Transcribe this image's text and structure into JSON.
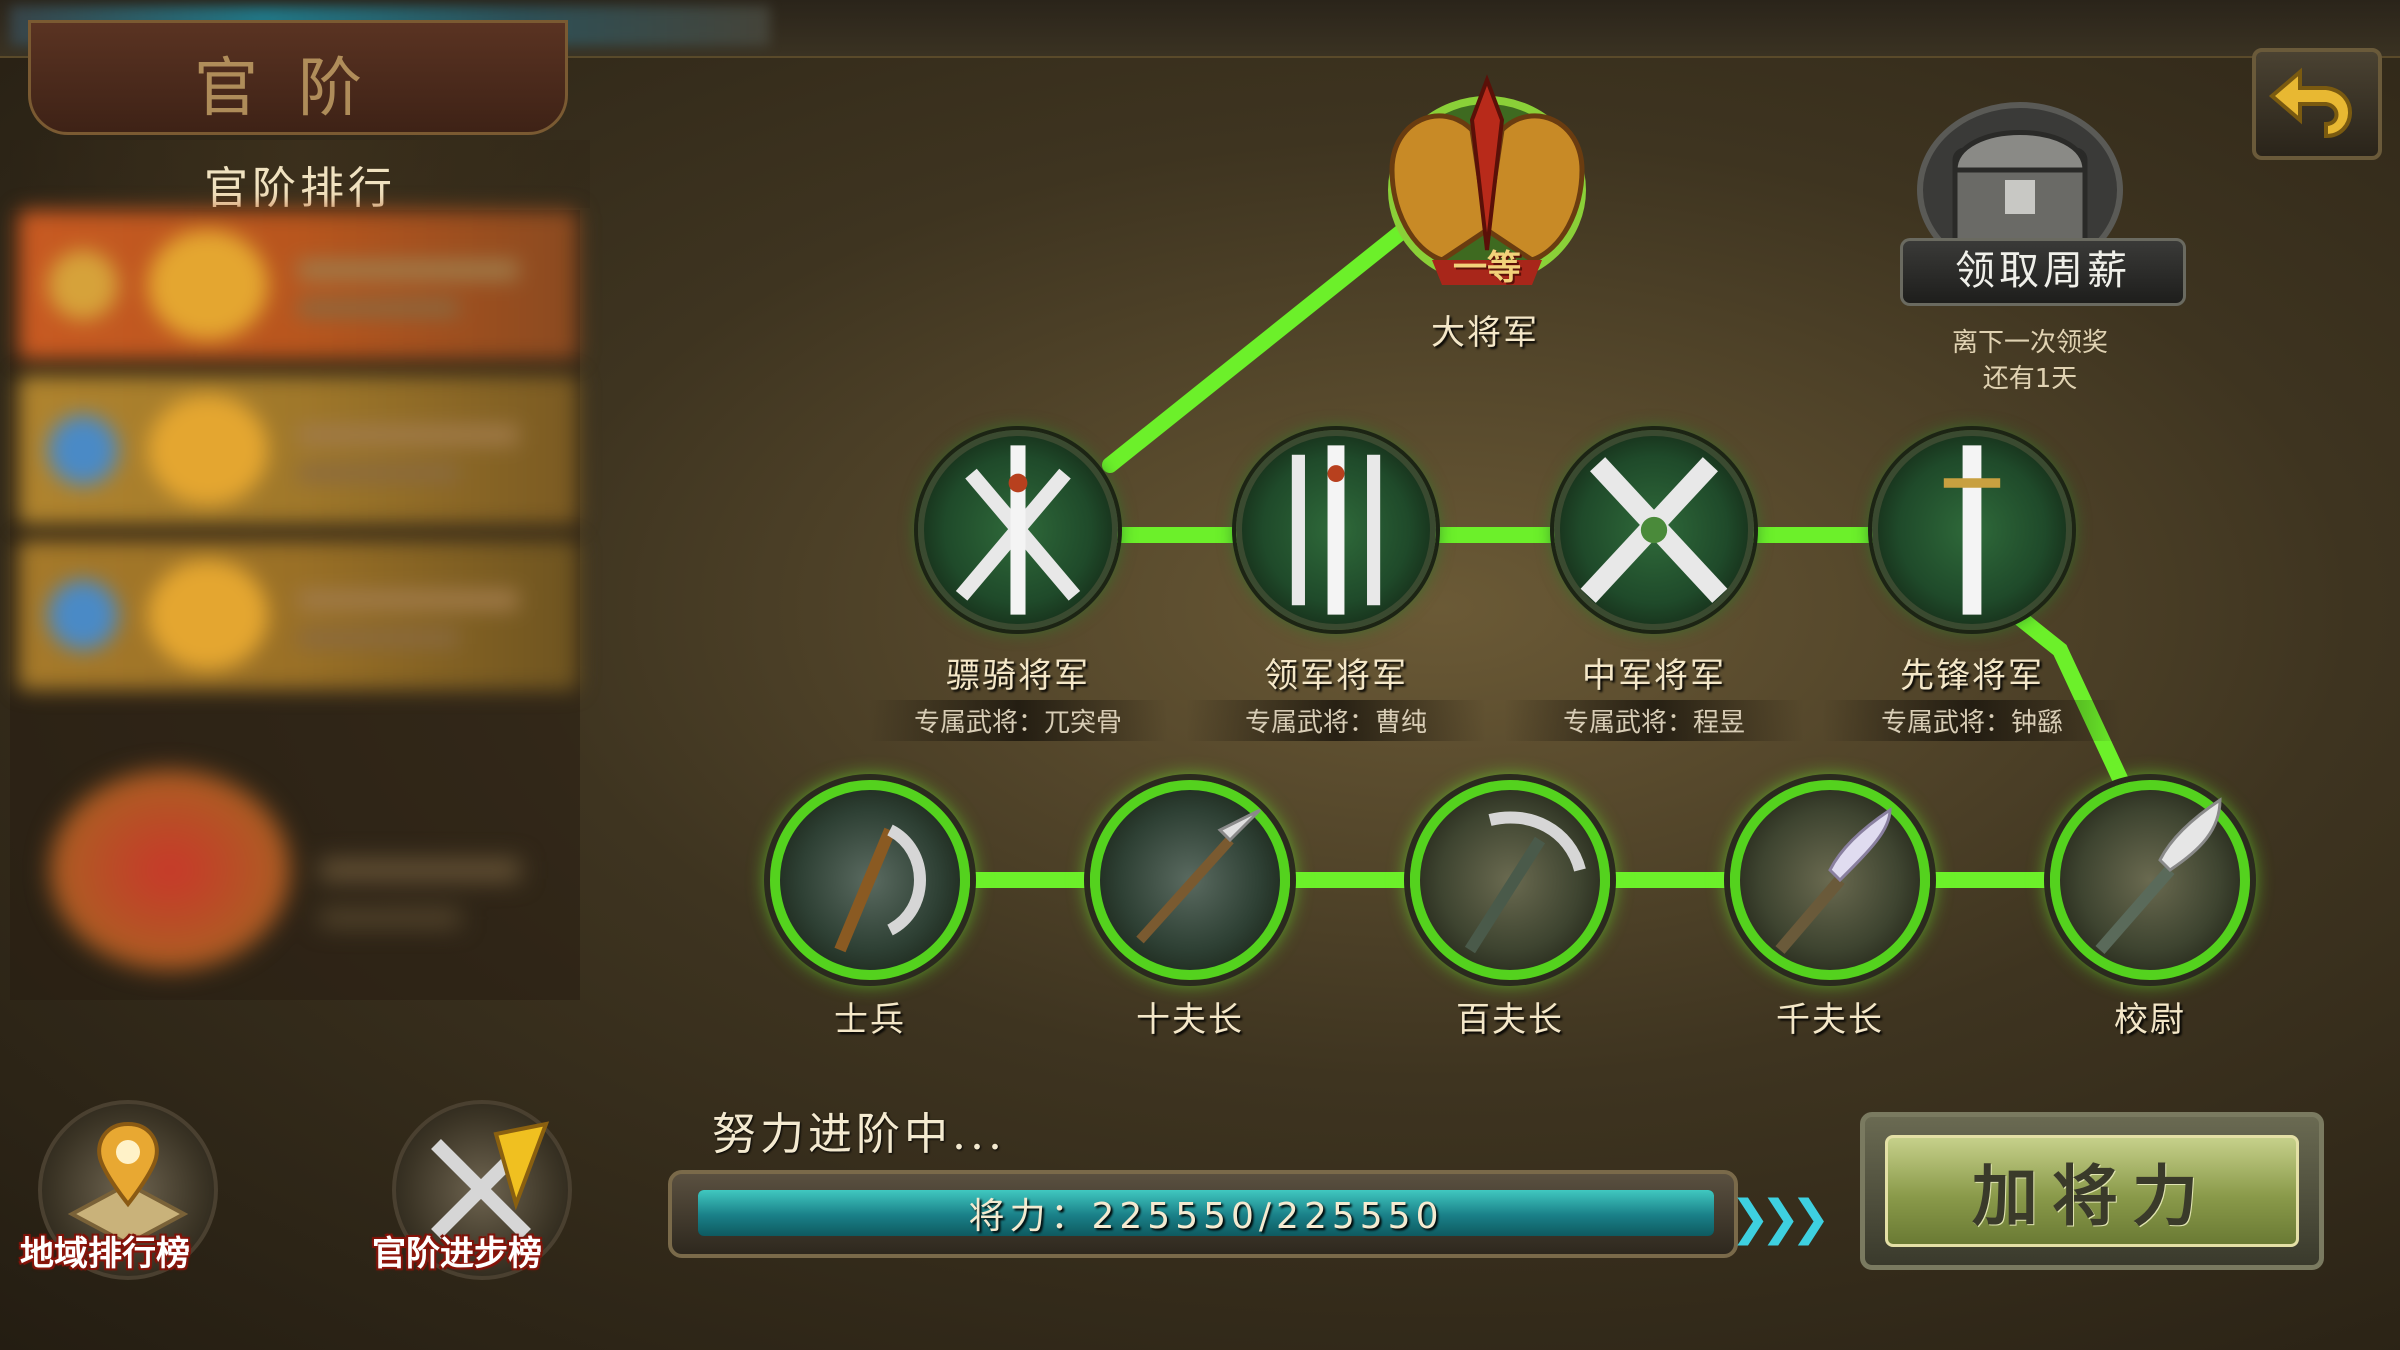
{
  "header": {
    "title": "官阶"
  },
  "ranking": {
    "title": "官阶排行"
  },
  "buttons": {
    "region_rank": "地域排行榜",
    "rank_progress": "官阶进步榜",
    "add_power": "加将力"
  },
  "top_rank": {
    "name": "大将军",
    "badge": "一等"
  },
  "weekly_salary": {
    "label": "领取周薪",
    "note_line1": "离下一次领奖",
    "note_line2": "还有1天"
  },
  "mid_ranks": [
    {
      "name": "骠骑将军",
      "general": "专属武将：兀突骨"
    },
    {
      "name": "领军将军",
      "general": "专属武将：曹纯"
    },
    {
      "name": "中军将军",
      "general": "专属武将：程昱"
    },
    {
      "name": "先锋将军",
      "general": "专属武将：钟繇"
    }
  ],
  "low_ranks": [
    {
      "name": "士兵"
    },
    {
      "name": "十夫长"
    },
    {
      "name": "百夫长"
    },
    {
      "name": "千夫长"
    },
    {
      "name": "校尉"
    }
  ],
  "progress": {
    "title": "努力进阶中...",
    "label": "将力：",
    "current": 225550,
    "max": 225550,
    "text": "将力：225550/225550",
    "fraction": 1.0
  },
  "colors": {
    "path_green": "#6cf02a",
    "accent_gold": "#e4a630",
    "bar_teal": "#1a8088"
  },
  "icons": {
    "back": "back-arrow-icon",
    "chest": "treasure-chest-icon",
    "region": "map-pin-icon",
    "progress_rank": "crossed-swords-arrow-icon"
  }
}
